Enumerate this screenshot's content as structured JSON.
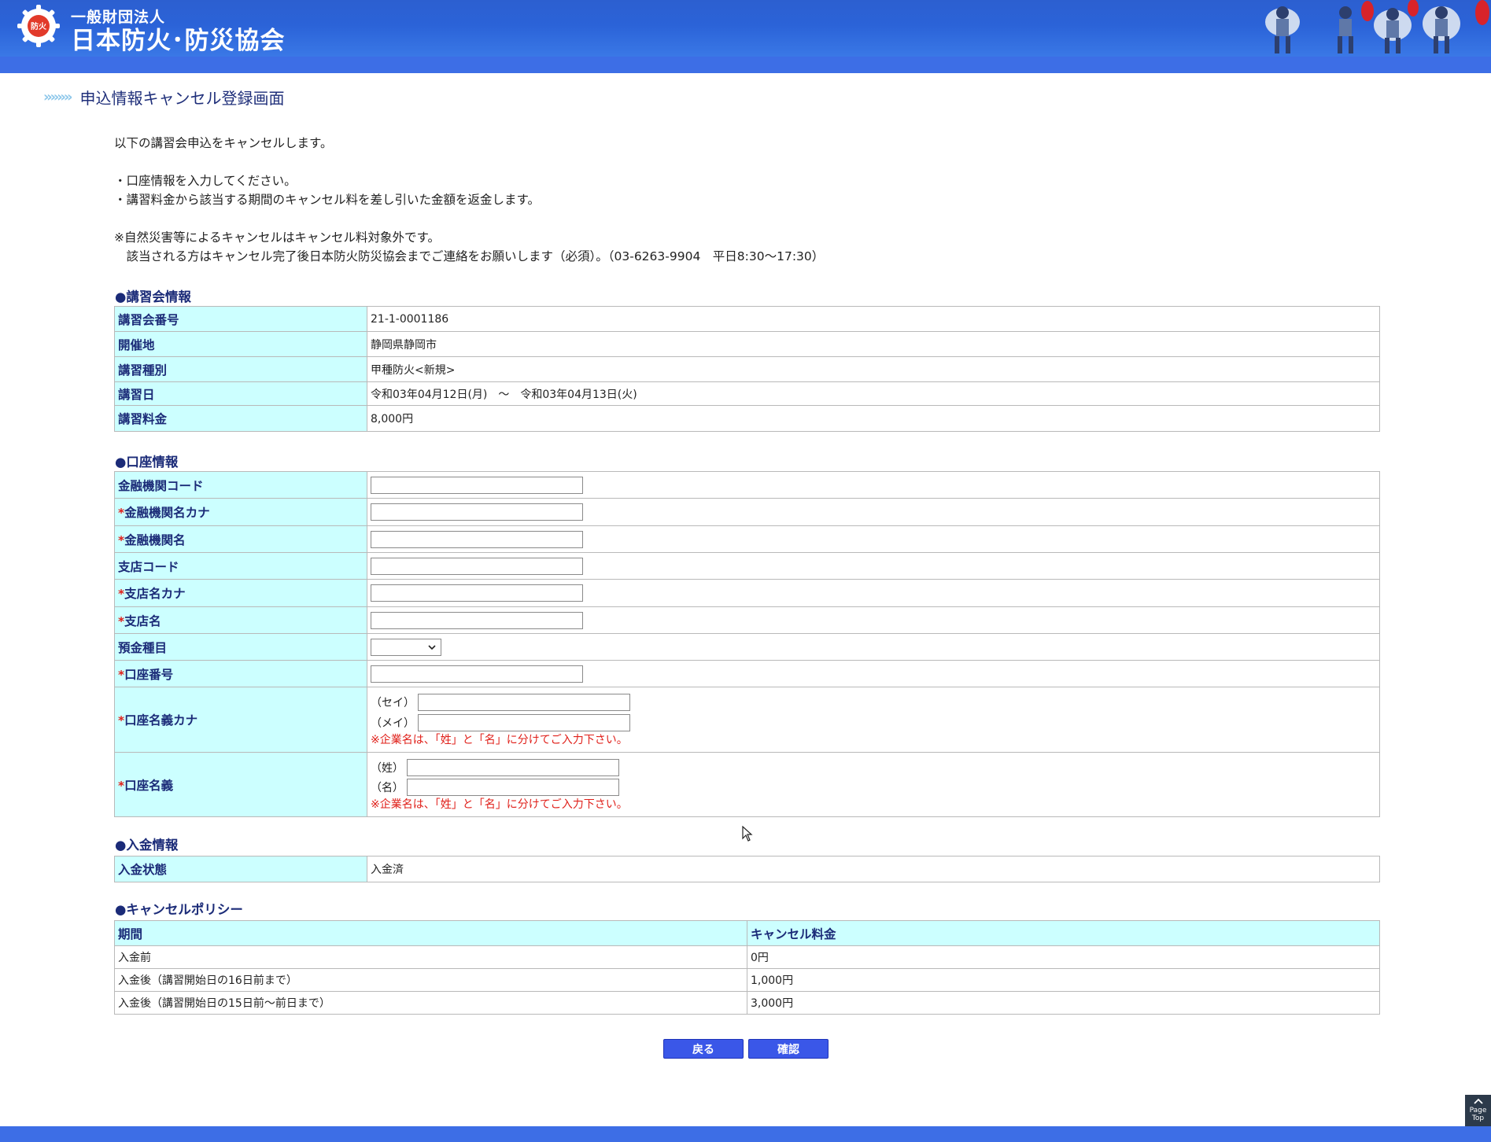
{
  "header": {
    "org_line1": "一般財団法人",
    "org_line2": "日本防火･防災協会",
    "logo_text": "防火"
  },
  "page_title": "申込情報キャンセル登録画面",
  "title_arrows": "»»»»",
  "intro": {
    "line1": "以下の講習会申込をキャンセルします。",
    "bullet1": "・口座情報を入力してください。",
    "bullet2": "・講習料金から該当する期間のキャンセル料を差し引いた金額を返金します。",
    "note1": "※自然災害等によるキャンセルはキャンセル料対象外です。",
    "note2": "　該当される方はキャンセル完了後日本防火防災協会までご連絡をお願いします（必須）。（03-6263-9904　平日8:30～17:30）"
  },
  "course_info": {
    "heading": "●講習会情報",
    "rows": [
      {
        "label": "講習会番号",
        "value": "21-1-0001186"
      },
      {
        "label": "開催地",
        "value": "静岡県静岡市"
      },
      {
        "label": "講習種別",
        "value": "甲種防火<新規>"
      },
      {
        "label": "講習日",
        "value": "令和03年04月12日(月)　～　令和03年04月13日(火)"
      },
      {
        "label": "講習料金",
        "value": "8,000円"
      }
    ]
  },
  "account_info": {
    "heading": "●口座情報",
    "required_mark": "*",
    "bank_code": {
      "label": "金融機関コード",
      "value": ""
    },
    "bank_name_kana": {
      "label": "金融機関名カナ",
      "value": ""
    },
    "bank_name": {
      "label": "金融機関名",
      "value": ""
    },
    "branch_code": {
      "label": "支店コード",
      "value": ""
    },
    "branch_name_kana": {
      "label": "支店名カナ",
      "value": ""
    },
    "branch_name": {
      "label": "支店名",
      "value": ""
    },
    "deposit_type": {
      "label": "預金種目",
      "value": ""
    },
    "account_number": {
      "label": "口座番号",
      "value": ""
    },
    "holder_kana": {
      "label": "口座名義カナ",
      "sei_label": "（セイ）",
      "mei_label": "（メイ）",
      "sei_value": "",
      "mei_value": "",
      "note": "※企業名は、「姓」と「名」に分けてご入力下さい。"
    },
    "holder_name": {
      "label": "口座名義",
      "sei_label": "（姓）",
      "mei_label": "（名）",
      "sei_value": "",
      "mei_value": "",
      "note": "※企業名は、「姓」と「名」に分けてご入力下さい。"
    }
  },
  "payment_info": {
    "heading": "●入金情報",
    "status_label": "入金状態",
    "status_value": "入金済"
  },
  "cancel_policy": {
    "heading": "●キャンセルポリシー",
    "col_period": "期間",
    "col_fee": "キャンセル料金",
    "rows": [
      {
        "period": "入金前",
        "fee": "0円"
      },
      {
        "period": "入金後（講習開始日の16日前まで）",
        "fee": "1,000円"
      },
      {
        "period": "入金後（講習開始日の15日前～前日まで）",
        "fee": "3,000円"
      }
    ]
  },
  "buttons": {
    "back": "戻る",
    "confirm": "確認"
  },
  "page_top": {
    "line1": "Page",
    "line2": "Top"
  },
  "colors": {
    "header_blue": "#2b63d8",
    "label_bg": "#ccffff",
    "label_text": "#1b2b78",
    "required_red": "#e0201a",
    "button_blue": "#3a57e8"
  }
}
